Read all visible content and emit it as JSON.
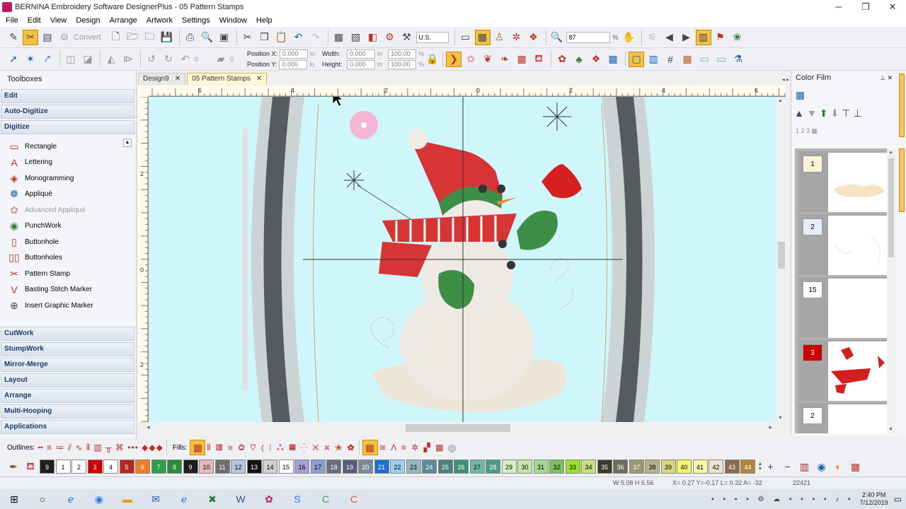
{
  "window": {
    "title": "BERNINA Embroidery Software DesignerPlus - 05 Pattern Stamps",
    "controls": [
      "─",
      "❐",
      "✕"
    ]
  },
  "menu": [
    "File",
    "Edit",
    "View",
    "Design",
    "Arrange",
    "Artwork",
    "Settings",
    "Window",
    "Help"
  ],
  "toolbar1": {
    "convert_label": "Convert",
    "units": "U.S.",
    "zoom_value": "87",
    "zoom_unit": "%"
  },
  "toolbar2": {
    "rotate_angle": "0",
    "slant_angle": "0",
    "position_x_label": "Position X:",
    "position_x": "0.000",
    "position_y_label": "Position Y:",
    "position_y": "0.000",
    "width_label": "Width:",
    "width": "0.000",
    "height_label": "Height:",
    "height": "0.000",
    "unit": "in",
    "scale_w": "100.00",
    "scale_h": "100.00",
    "scale_unit": "%"
  },
  "toolboxes": {
    "title": "Toolboxes",
    "groups_top": [
      "Edit",
      "Auto-Digitize",
      "Digitize"
    ],
    "digitize_tools": [
      {
        "label": "Rectangle",
        "icon": "rectangle-icon",
        "glyph": "▭"
      },
      {
        "label": "Lettering",
        "icon": "lettering-icon",
        "glyph": "A"
      },
      {
        "label": "Monogramming",
        "icon": "monogram-icon",
        "glyph": "◈"
      },
      {
        "label": "Appliqué",
        "icon": "applique-icon",
        "glyph": "❁"
      },
      {
        "label": "Advanced Appliqué",
        "icon": "advanced-applique-icon",
        "glyph": "✿"
      },
      {
        "label": "PunchWork",
        "icon": "punchwork-icon",
        "glyph": "◉"
      },
      {
        "label": "Buttonhole",
        "icon": "buttonhole-icon",
        "glyph": "▯"
      },
      {
        "label": "Buttonholes",
        "icon": "buttonholes-icon",
        "glyph": "▯▯"
      },
      {
        "label": "Pattern Stamp",
        "icon": "pattern-stamp-icon",
        "glyph": "✂"
      },
      {
        "label": "Basting Stitch Marker",
        "icon": "basting-marker-icon",
        "glyph": "V"
      },
      {
        "label": "Insert Graphic Marker",
        "icon": "graphic-marker-icon",
        "glyph": "⊕"
      }
    ],
    "groups_bottom": [
      "CutWork",
      "StumpWork",
      "Mirror-Merge",
      "Layout",
      "Arrange",
      "Multi-Hooping",
      "Applications"
    ]
  },
  "doc_tabs": [
    {
      "label": "Design9",
      "active": false
    },
    {
      "label": "05 Pattern Stamps",
      "active": true
    }
  ],
  "ruler": {
    "h_labels": [
      "6",
      "4",
      "2",
      "0",
      "2",
      "4",
      "6"
    ],
    "v_labels": [
      "2",
      "0",
      "2"
    ]
  },
  "color_film": {
    "title": "Color Film",
    "items": [
      {
        "number": "1",
        "selected": false,
        "num_bg": "#fdf3da",
        "thumb": "cream"
      },
      {
        "number": "2",
        "selected": false,
        "num_bg": "#e4edf9",
        "thumb": "white"
      },
      {
        "number": "15",
        "selected": false,
        "num_bg": "#ffffff",
        "thumb": "blank"
      },
      {
        "number": "3",
        "selected": true,
        "num_bg": "#cc0000",
        "thumb": "red"
      },
      {
        "number": "2",
        "selected": false,
        "num_bg": "#ffffff",
        "thumb": "white"
      }
    ]
  },
  "bottom_toolbar": {
    "outlines_label": "Outlines:",
    "fills_label": "Fills:"
  },
  "palette": [
    {
      "n": "9",
      "c": "#1e1e1e",
      "t": "#fff"
    },
    {
      "n": "1",
      "c": "#fffef8",
      "t": "#000"
    },
    {
      "n": "2",
      "c": "#ffffff",
      "t": "#000"
    },
    {
      "n": "3",
      "c": "#cc0000",
      "t": "#fff"
    },
    {
      "n": "4",
      "c": "#ffffff",
      "t": "#000"
    },
    {
      "n": "5",
      "c": "#b5261e",
      "t": "#fff"
    },
    {
      "n": "6",
      "c": "#f07c28",
      "t": "#fff"
    },
    {
      "n": "7",
      "c": "#2e9e48",
      "t": "#fff"
    },
    {
      "n": "8",
      "c": "#2a8a3a",
      "t": "#fff"
    },
    {
      "n": "9",
      "c": "#1b1b1b",
      "t": "#fff"
    },
    {
      "n": "10",
      "c": "#e7b7bd",
      "t": "#000"
    },
    {
      "n": "11",
      "c": "#6e6e6e",
      "t": "#fff"
    },
    {
      "n": "12",
      "c": "#b7c6db",
      "t": "#000"
    },
    {
      "n": "13",
      "c": "#121212",
      "t": "#fff"
    },
    {
      "n": "14",
      "c": "#cfcfcf",
      "t": "#000"
    },
    {
      "n": "15",
      "c": "#ffffff",
      "t": "#000"
    },
    {
      "n": "16",
      "c": "#a99fd6",
      "t": "#000"
    },
    {
      "n": "17",
      "c": "#8b9ed2",
      "t": "#000"
    },
    {
      "n": "18",
      "c": "#6c6c80",
      "t": "#fff"
    },
    {
      "n": "19",
      "c": "#5a5a7a",
      "t": "#fff"
    },
    {
      "n": "20",
      "c": "#7a8898",
      "t": "#fff"
    },
    {
      "n": "21",
      "c": "#1f6fd2",
      "t": "#fff"
    },
    {
      "n": "22",
      "c": "#9bd0f0",
      "t": "#000"
    },
    {
      "n": "23",
      "c": "#92b9c3",
      "t": "#000"
    },
    {
      "n": "24",
      "c": "#5b8a9a",
      "t": "#fff"
    },
    {
      "n": "25",
      "c": "#4c7f7f",
      "t": "#fff"
    },
    {
      "n": "26",
      "c": "#3e8f7a",
      "t": "#fff"
    },
    {
      "n": "27",
      "c": "#6fb9a4",
      "t": "#000"
    },
    {
      "n": "28",
      "c": "#4a9a8a",
      "t": "#fff"
    },
    {
      "n": "29",
      "c": "#d6efc6",
      "t": "#000"
    },
    {
      "n": "30",
      "c": "#c4e5a7",
      "t": "#000"
    },
    {
      "n": "31",
      "c": "#a7d88e",
      "t": "#000"
    },
    {
      "n": "32",
      "c": "#7dbf5a",
      "t": "#000"
    },
    {
      "n": "33",
      "c": "#9be02d",
      "t": "#000"
    },
    {
      "n": "34",
      "c": "#c6e07a",
      "t": "#000"
    },
    {
      "n": "35",
      "c": "#3a3a2a",
      "t": "#fff"
    },
    {
      "n": "36",
      "c": "#6e6e58",
      "t": "#fff"
    },
    {
      "n": "37",
      "c": "#999970",
      "t": "#fff"
    },
    {
      "n": "38",
      "c": "#b4b089",
      "t": "#000"
    },
    {
      "n": "39",
      "c": "#d7d57a",
      "t": "#000"
    },
    {
      "n": "40",
      "c": "#f7f56a",
      "t": "#000"
    },
    {
      "n": "41",
      "c": "#fbf7a8",
      "t": "#000"
    },
    {
      "n": "42",
      "c": "#e9e6cc",
      "t": "#000"
    },
    {
      "n": "43",
      "c": "#8a6b4e",
      "t": "#fff"
    },
    {
      "n": "44",
      "c": "#b5873c",
      "t": "#fff"
    }
  ],
  "status": {
    "size": "W 5.08 H 6.56",
    "coords": "X= 0.27 Y=-0.17 L= 0.32 A= -32",
    "stitches": "22421"
  },
  "taskbar": {
    "time": "2:40 PM",
    "date": "7/12/2019"
  }
}
